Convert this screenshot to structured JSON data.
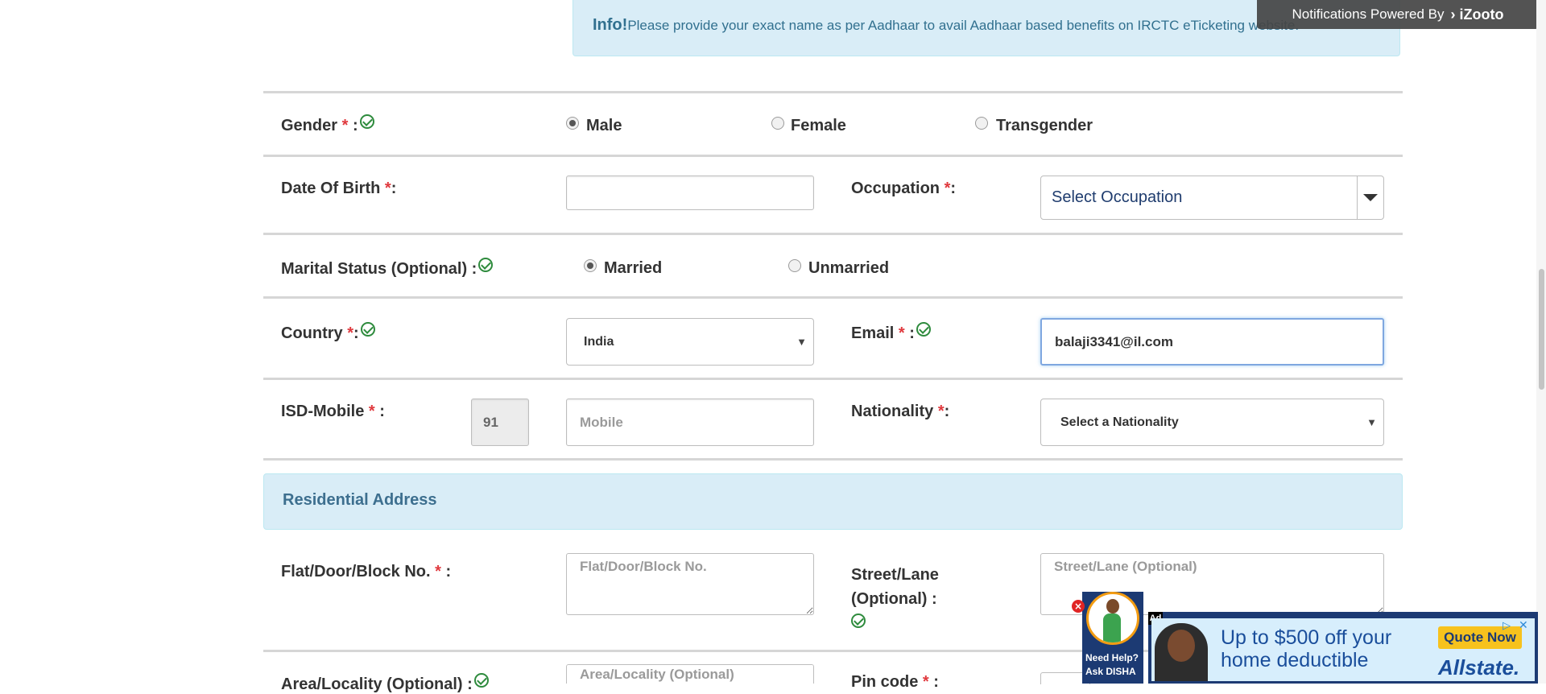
{
  "info_banner": {
    "bold": "Info!",
    "text": "Please provide your exact name as per Aadhaar to avail Aadhaar based benefits on IRCTC eTicketing website."
  },
  "notification": {
    "text": "Notifications Powered By",
    "brand": "iZooto"
  },
  "gender": {
    "label": "Gender",
    "options": [
      "Male",
      "Female",
      "Transgender"
    ],
    "selected": "Male"
  },
  "dob": {
    "label": "Date Of Birth",
    "value": ""
  },
  "occupation": {
    "label": "Occupation",
    "selected": "Select Occupation"
  },
  "marital": {
    "label": "Marital Status (Optional) :",
    "options": [
      "Married",
      "Unmarried"
    ],
    "selected": "Married"
  },
  "country": {
    "label": "Country",
    "selected": "India"
  },
  "email": {
    "label": "Email",
    "value": "balaji3341@il.com"
  },
  "isd_mobile": {
    "label": "ISD-Mobile",
    "isd": "91",
    "mobile_placeholder": "Mobile"
  },
  "nationality": {
    "label": "Nationality",
    "selected": "Select a Nationality"
  },
  "residential": {
    "heading": "Residential Address"
  },
  "flat": {
    "label": "Flat/Door/Block No.",
    "placeholder": "Flat/Door/Block No."
  },
  "street": {
    "label_line1": "Street/Lane",
    "label_line2": "(Optional) :",
    "placeholder": "Street/Lane (Optional)"
  },
  "area": {
    "label": "Area/Locality (Optional) :",
    "placeholder": "Area/Locality (Optional)"
  },
  "pincode": {
    "label": "Pin code"
  },
  "symbols": {
    "required": "*",
    "colon": ":",
    "required_colon": "*:",
    "required_space_colon": "* :",
    "required_trailing": "* :"
  },
  "disha": {
    "line1": "Need Help?",
    "line2": "Ask DISHA"
  },
  "ad": {
    "badge": "Ad",
    "line1": "Up to $500 off your",
    "line2": "home deductible",
    "cta": "Quote Now",
    "brand": "Allstate."
  },
  "colors": {
    "info_bg": "#d9edf7",
    "info_text": "#31708f",
    "required": "#e0393e",
    "check": "#2e8b3d",
    "ad_bg": "#1a5fb4",
    "cta_bg": "#f7c21d"
  }
}
